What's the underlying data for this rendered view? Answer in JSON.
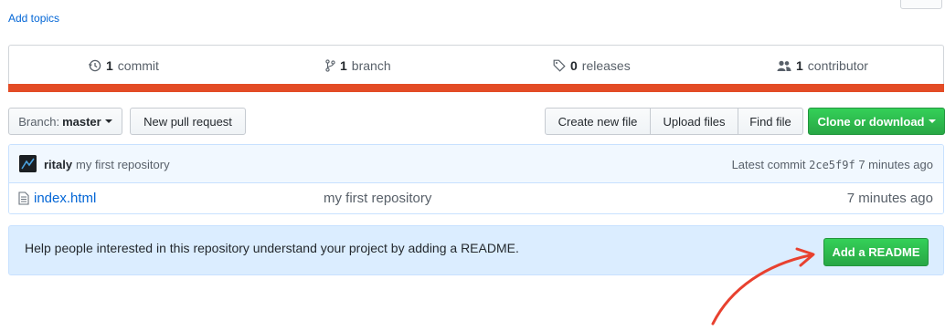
{
  "topics": {
    "add_label": "Add topics"
  },
  "summary": {
    "commits": {
      "count": "1",
      "label": "commit",
      "icon": "history-icon"
    },
    "branches": {
      "count": "1",
      "label": "branch",
      "icon": "git-branch-icon"
    },
    "releases": {
      "count": "0",
      "label": "releases",
      "icon": "tag-icon"
    },
    "contributors": {
      "count": "1",
      "label": "contributor",
      "icon": "people-icon"
    },
    "language_color": "#e34c26"
  },
  "toolbar": {
    "branch_prefix": "Branch:",
    "branch_name": "master",
    "new_pull_request": "New pull request",
    "create_new_file": "Create new file",
    "upload_files": "Upload files",
    "find_file": "Find file",
    "clone_or_download": "Clone or download"
  },
  "commit": {
    "author": "ritaly",
    "message": "my first repository",
    "latest_label": "Latest commit",
    "sha": "2ce5f9f",
    "age": "7 minutes ago"
  },
  "files": [
    {
      "name": "index.html",
      "message": "my first repository",
      "age": "7 minutes ago",
      "icon": "file-icon"
    }
  ],
  "readme": {
    "text": "Help people interested in this repository understand your project by adding a README.",
    "button": "Add a README"
  },
  "colors": {
    "accent_green": "#28a745",
    "link_blue": "#0366d6",
    "annotation_arrow": "#e8412f"
  }
}
